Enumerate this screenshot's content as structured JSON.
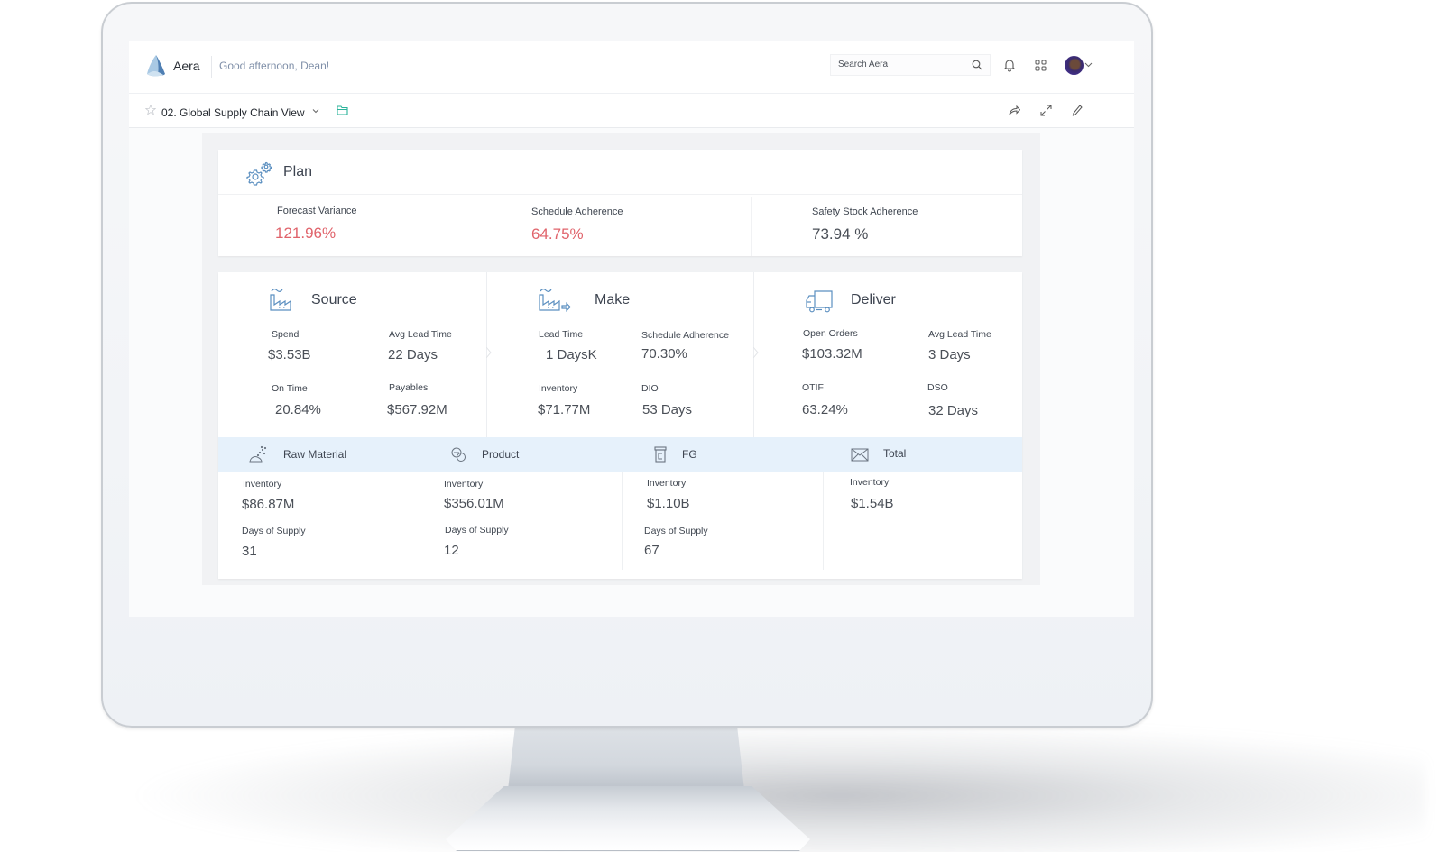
{
  "header": {
    "brand": "Aera",
    "greeting": "Good afternoon, Dean!",
    "search": {
      "placeholder": "Search Aera",
      "value": ""
    },
    "icons": [
      "search-icon",
      "bell-icon",
      "apps-grid-icon",
      "avatar",
      "chevron-down-icon"
    ]
  },
  "viewbar": {
    "title": "02. Global Supply Chain View",
    "icons": [
      "star-icon",
      "chevron-down-icon",
      "folder-icon",
      "share-icon",
      "expand-icon",
      "pencil-icon"
    ]
  },
  "plan": {
    "title": "Plan",
    "icon": "gears-icon",
    "kpis": [
      {
        "label": "Forecast Variance",
        "value": "121.96%",
        "status": "alert"
      },
      {
        "label": "Schedule Adherence",
        "value": "64.75%",
        "status": "alert"
      },
      {
        "label": "Safety Stock Adherence",
        "value": "73.94 %",
        "status": "normal"
      }
    ]
  },
  "sections": [
    {
      "title": "Source",
      "icon": "factory-icon",
      "metrics": [
        {
          "label": "Spend",
          "value": "$3.53B",
          "status": "normal"
        },
        {
          "label": "Avg Lead Time",
          "value": "22 Days",
          "status": "normal"
        },
        {
          "label": "On Time",
          "value": "20.84%",
          "status": "alert"
        },
        {
          "label": "Payables",
          "value": "$567.92M",
          "status": "normal"
        }
      ]
    },
    {
      "title": "Make",
      "icon": "factory-output-icon",
      "metrics": [
        {
          "label": "Lead Time",
          "value": "1 DaysK",
          "status": "normal"
        },
        {
          "label": "Schedule Adherence",
          "value": "70.30%",
          "status": "normal"
        },
        {
          "label": "Inventory",
          "value": "$71.77M",
          "status": "normal"
        },
        {
          "label": "DIO",
          "value": "53 Days",
          "status": "normal"
        }
      ]
    },
    {
      "title": "Deliver",
      "icon": "truck-icon",
      "metrics": [
        {
          "label": "Open Orders",
          "value": "$103.32M",
          "status": "normal"
        },
        {
          "label": "Avg Lead Time",
          "value": "3 Days",
          "status": "normal"
        },
        {
          "label": "OTIF",
          "value": "63.24%",
          "status": "normal"
        },
        {
          "label": "DSO",
          "value": "32 Days",
          "status": "normal"
        }
      ]
    }
  ],
  "inventory": [
    {
      "title": "Raw Material",
      "icon": "raw-material-icon",
      "inventory_label": "Inventory",
      "inventory": "$86.87M",
      "dos_label": "Days of Supply",
      "dos": "31"
    },
    {
      "title": "Product",
      "icon": "product-icon",
      "inventory_label": "Inventory",
      "inventory": "$356.01M",
      "dos_label": "Days of Supply",
      "dos": "12"
    },
    {
      "title": "FG",
      "icon": "fg-container-icon",
      "inventory_label": "Inventory",
      "inventory": "$1.10B",
      "dos_label": "Days of Supply",
      "dos": "67"
    },
    {
      "title": "Total",
      "icon": "envelope-icon",
      "inventory_label": "Inventory",
      "inventory": "$1.54B"
    }
  ],
  "colors": {
    "alert": "#e0636b",
    "icon_blue": "#5b8fc0",
    "band": "#e6f1fb",
    "greeting": "#7f8fa8"
  }
}
